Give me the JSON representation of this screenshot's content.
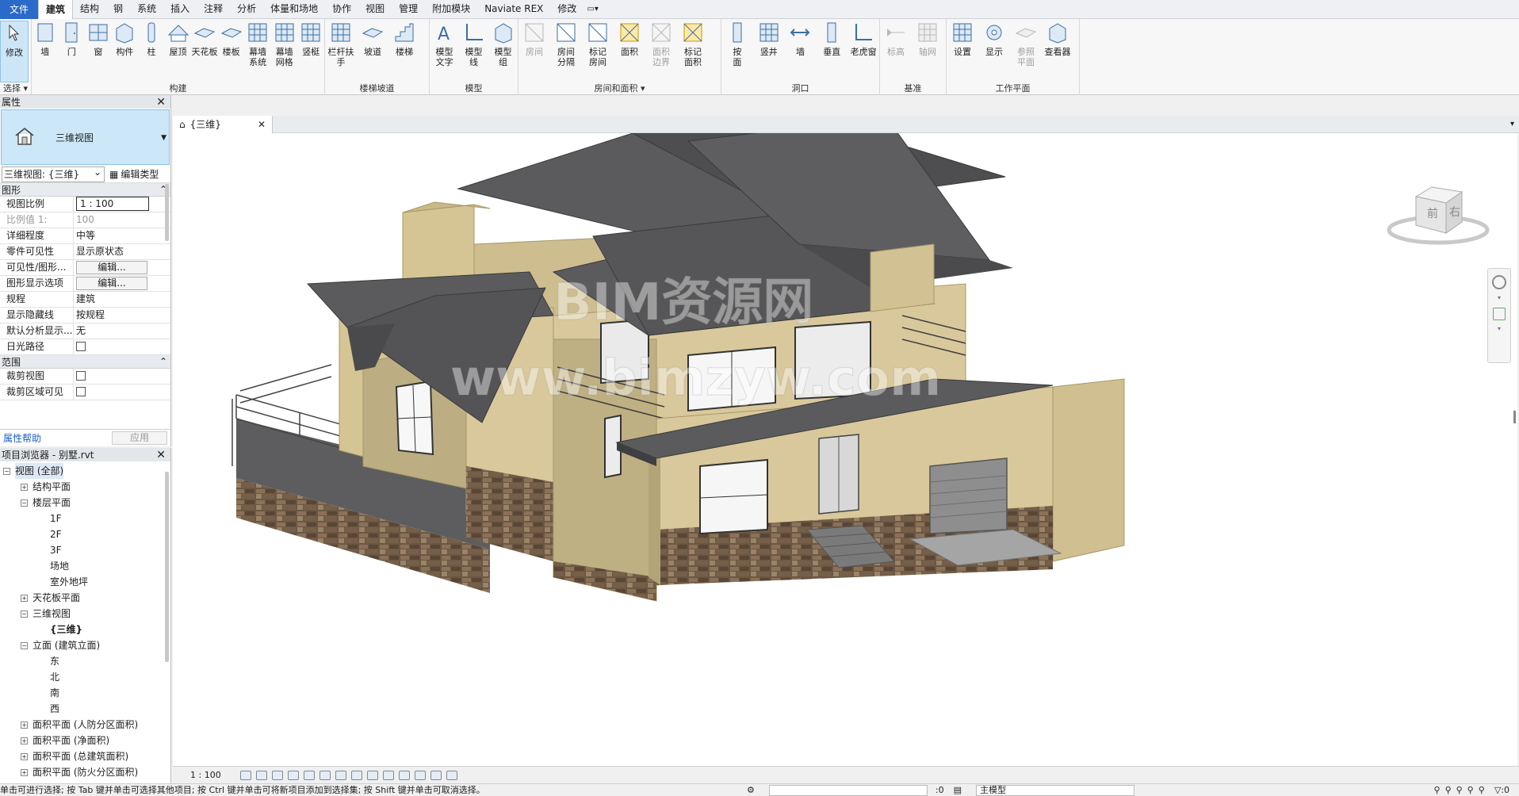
{
  "menu": {
    "file": "文件",
    "tabs": [
      "建筑",
      "结构",
      "钢",
      "系统",
      "插入",
      "注释",
      "分析",
      "体量和场地",
      "协作",
      "视图",
      "管理",
      "附加模块",
      "Naviate REX",
      "修改"
    ]
  },
  "ribbon": {
    "select": {
      "modify": "修改",
      "label": "选择"
    },
    "build": {
      "label": "构建",
      "items": [
        "墙",
        "门",
        "窗",
        "构件",
        "柱",
        "屋顶",
        "天花板",
        "楼板",
        "幕墙\n系统",
        "幕墙\n网格",
        "竖梃"
      ]
    },
    "stairs": {
      "label": "楼梯坡道",
      "items": [
        "栏杆扶手",
        "坡道",
        "楼梯"
      ]
    },
    "model": {
      "label": "模型",
      "items": [
        "模型\n文字",
        "模型\n线",
        "模型\n组"
      ]
    },
    "room": {
      "label": "房间和面积",
      "items": [
        "房间",
        "房间\n分隔",
        "标记\n房间",
        "面积",
        "面积\n边界",
        "标记\n面积"
      ]
    },
    "opening": {
      "label": "洞口",
      "items": [
        "按\n面",
        "竖井",
        "墙",
        "垂直",
        "老虎窗"
      ]
    },
    "datum": {
      "label": "基准",
      "items": [
        "标高",
        "轴网"
      ]
    },
    "workplane": {
      "label": "工作平面",
      "items": [
        "设置",
        "显示",
        "参照\n平面",
        "查看器"
      ]
    }
  },
  "properties": {
    "title": "属性",
    "type_name": "三维视图",
    "view_selector": "三维视图: {三维}",
    "edit_type": "编辑类型",
    "sections": [
      {
        "name": "图形",
        "rows": [
          {
            "key": "视图比例",
            "value": "1 : 100",
            "kind": "input"
          },
          {
            "key": "比例值 1:",
            "value": "100",
            "kind": "dim"
          },
          {
            "key": "详细程度",
            "value": "中等",
            "kind": "text"
          },
          {
            "key": "零件可见性",
            "value": "显示原状态",
            "kind": "text"
          },
          {
            "key": "可见性/图形...",
            "value": "编辑...",
            "kind": "button"
          },
          {
            "key": "图形显示选项",
            "value": "编辑...",
            "kind": "button"
          },
          {
            "key": "规程",
            "value": "建筑",
            "kind": "text"
          },
          {
            "key": "显示隐藏线",
            "value": "按规程",
            "kind": "text"
          },
          {
            "key": "默认分析显示...",
            "value": "无",
            "kind": "text"
          },
          {
            "key": "日光路径",
            "value": "",
            "kind": "checkbox"
          }
        ]
      },
      {
        "name": "范围",
        "rows": [
          {
            "key": "裁剪视图",
            "value": "",
            "kind": "checkbox"
          },
          {
            "key": "裁剪区域可见",
            "value": "",
            "kind": "checkbox"
          }
        ]
      }
    ],
    "help": "属性帮助",
    "apply": "应用"
  },
  "browser": {
    "title": "项目浏览器 - 别墅.rvt",
    "tree": [
      {
        "label": "视图 (全部)",
        "level": 0,
        "toggle": "⊟",
        "selected": true
      },
      {
        "label": "结构平面",
        "level": 1,
        "toggle": "⊞"
      },
      {
        "label": "楼层平面",
        "level": 1,
        "toggle": "⊟"
      },
      {
        "label": "1F",
        "level": 2
      },
      {
        "label": "2F",
        "level": 2
      },
      {
        "label": "3F",
        "level": 2
      },
      {
        "label": "场地",
        "level": 2
      },
      {
        "label": "室外地坪",
        "level": 2
      },
      {
        "label": "天花板平面",
        "level": 1,
        "toggle": "⊞"
      },
      {
        "label": "三维视图",
        "level": 1,
        "toggle": "⊟"
      },
      {
        "label": "{三维}",
        "level": 2,
        "bold": true
      },
      {
        "label": "立面 (建筑立面)",
        "level": 1,
        "toggle": "⊟"
      },
      {
        "label": "东",
        "level": 2
      },
      {
        "label": "北",
        "level": 2
      },
      {
        "label": "南",
        "level": 2
      },
      {
        "label": "西",
        "level": 2
      },
      {
        "label": "面积平面 (人防分区面积)",
        "level": 1,
        "toggle": "⊞"
      },
      {
        "label": "面积平面 (净面积)",
        "level": 1,
        "toggle": "⊞"
      },
      {
        "label": "面积平面 (总建筑面积)",
        "level": 1,
        "toggle": "⊞"
      },
      {
        "label": "面积平面 (防火分区面积)",
        "level": 1,
        "toggle": "⊞"
      }
    ]
  },
  "view_tab": {
    "label": "{三维}"
  },
  "viewcube": {
    "front": "前",
    "right": "右"
  },
  "watermark": {
    "line1": "BIM资源网",
    "line2": "www.bimzyw.com"
  },
  "view_control": {
    "scale": "1 : 100"
  },
  "status": {
    "message": "单击可进行选择; 按 Tab 键并单击可选择其他项目; 按 Ctrl 键并单击可将新项目添加到选择集; 按 Shift 键并单击可取消选择。",
    "count": ":0",
    "model": "主模型",
    "filter_count": ":0"
  },
  "colors": {
    "accent": "#2a6ac8",
    "selection": "#cce8f8",
    "roof": "#5b5b5d",
    "wall": "#d9c89b"
  }
}
